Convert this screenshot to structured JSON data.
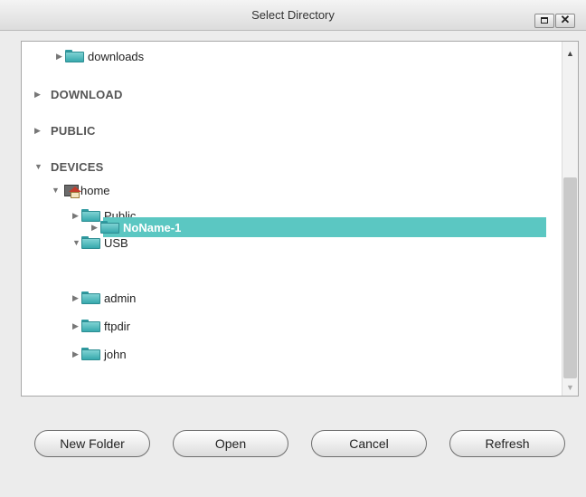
{
  "window": {
    "title": "Select Directory",
    "maximize_icon": "maximize-icon",
    "close_icon": "close-icon",
    "close_glyph": "✕"
  },
  "tree": {
    "expanded_glyph": "▼",
    "collapsed_glyph": "▶",
    "items": [
      {
        "label": "downloads",
        "type": "folder",
        "expanded": false
      },
      {
        "label": "DOWNLOAD",
        "type": "section",
        "expanded": false
      },
      {
        "label": "PUBLIC",
        "type": "section",
        "expanded": false
      },
      {
        "label": "DEVICES",
        "type": "section",
        "expanded": true
      },
      {
        "label": "home",
        "type": "home",
        "expanded": true
      },
      {
        "label": "Public",
        "type": "folder",
        "expanded": false
      },
      {
        "label": "USB",
        "type": "folder",
        "expanded": true
      },
      {
        "label": "NoName-1",
        "type": "folder",
        "expanded": false,
        "selected": true
      },
      {
        "label": "admin",
        "type": "folder",
        "expanded": false
      },
      {
        "label": "ftpdir",
        "type": "folder",
        "expanded": false
      },
      {
        "label": "john",
        "type": "folder",
        "expanded": false
      }
    ],
    "selection_color": "#5bc7c2",
    "folder_color": "#37a9ad"
  },
  "buttons": {
    "new_folder": "New Folder",
    "open": "Open",
    "cancel": "Cancel",
    "refresh": "Refresh"
  }
}
